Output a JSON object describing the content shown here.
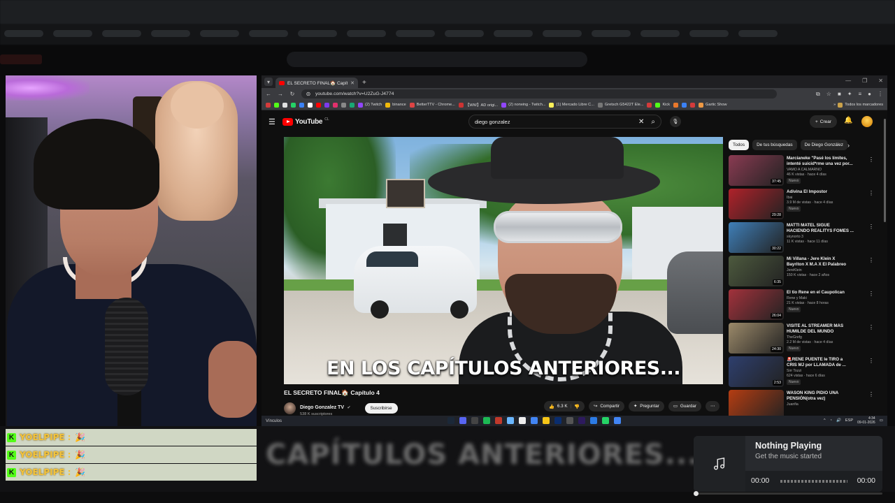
{
  "chat": {
    "messages": [
      {
        "badge": "K",
        "user": "YOELPIPE",
        "sep": ":",
        "emote": "🎉"
      },
      {
        "badge": "K",
        "user": "YOELPIPE",
        "sep": ":",
        "emote": "🎉"
      },
      {
        "badge": "K",
        "user": "YOELPIPE",
        "sep": ":",
        "emote": "🎉"
      }
    ]
  },
  "background": {
    "overlay_text": "CAPÍTULOS ANTERIORES..."
  },
  "browser": {
    "tab_title": "EL SECRETO FINAL🏠 Capítulo 4",
    "url": "youtube.com/watch?v=U2ZuG-J4774",
    "bookmarks": [
      "(2) Twitch",
      "binance",
      "BetterTTV - Chrome...",
      "【WW】AD origi...",
      "(2) norwing - Twitch...",
      "(1) Mercado Libre C...",
      "Gretsch G5422T Ele...",
      "Kick",
      "Gartic Show"
    ],
    "bookmarks_right": "Todos los marcadores"
  },
  "youtube": {
    "logo_text": "YouTube",
    "logo_country": "CL",
    "search_query": "diego gonzalez",
    "create_label": "Crear",
    "subtitle": "EN LOS CAPÍTULOS ANTERIORES...",
    "video_title": "EL SECRETO FINAL🏠 Capítulo 4",
    "channel_name": "Diego Gonzalez TV",
    "channel_subs": "538 K suscriptores",
    "subscribe_label": "Suscribirse",
    "actions": {
      "likes": "6.3 K",
      "share": "Compartir",
      "ask": "Preguntar",
      "save": "Guardar"
    },
    "chips": [
      "Todos",
      "De tus búsquedas",
      "De Diego González"
    ],
    "recommendations": [
      {
        "title": "Marcianeke \"Pasé los límites, intenté suicid*rme una vez por...",
        "channel": "VAMO A CALMARNO",
        "meta": "46 K vistas · hace 4 días",
        "badge": "Nuevo",
        "duration": "37:45",
        "thumb": "#8a3b52"
      },
      {
        "title": "Adivina El Impostor",
        "channel": "Ibai",
        "meta": "3.9 M de vistas · hace 4 días",
        "badge": "Nuevo",
        "duration": "29:28",
        "thumb": "#b0222a"
      },
      {
        "title": "MATTI MATEL SIGUE HACIENDO REALITYS FOMES ...",
        "channel": "skynorto 3",
        "meta": "11 K vistas · hace 11 días",
        "badge": "",
        "duration": "30:22",
        "thumb": "#3f7fb8"
      },
      {
        "title": "Mi Villana - Jere Klein X Bayriton X M.A X El Palabreo",
        "channel": "JereKlein",
        "meta": "150 K vistas · hace 2 años",
        "badge": "",
        "duration": "6:35",
        "thumb": "#4d5a3e"
      },
      {
        "title": "El tio Rene en el Caupolican",
        "channel": "Rene y Maki",
        "meta": "21 K vistas · hace 8 horas",
        "badge": "Nuevo",
        "duration": "26:04",
        "thumb": "#a3323c"
      },
      {
        "title": "VISITÉ AL STREAMER MÁS HUMILDE DEL MUNDO",
        "channel": "TheGrefg",
        "meta": "2.2 M de vistas · hace 4 días",
        "badge": "Nuevo",
        "duration": "24:30",
        "thumb": "#9c8a6a"
      },
      {
        "title": "🚨RENE PUENTE le TIRÓ a CRIS MJ por LLAMADA de ...",
        "channel": "Sirr Tozzi",
        "meta": "624 vistas · hace 6 días",
        "badge": "Nuevo",
        "duration": "2:53",
        "thumb": "#2e3f6e"
      },
      {
        "title": "WASON KING PIDIO UNA PENSIÓN(otra vez)",
        "channel": "Juanfia",
        "meta": "",
        "badge": "",
        "duration": "",
        "thumb": "#b53d12"
      }
    ]
  },
  "taskbar": {
    "search_label": "Vínculos",
    "lang": "ESP",
    "time": "4:34",
    "date": "09-01-2026"
  },
  "music": {
    "title": "Nothing Playing",
    "subtitle": "Get the music started",
    "time_current": "00:00",
    "time_total": "00:00",
    "progress": 0
  },
  "colors": {
    "yt_red": "#ff0000",
    "kick_green": "#53fc18",
    "chat_user": "#f3c33b"
  }
}
